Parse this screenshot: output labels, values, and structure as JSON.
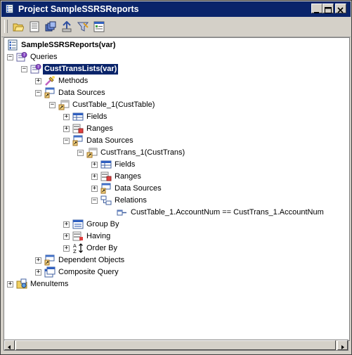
{
  "window": {
    "title": "Project SampleSSRSReports"
  },
  "toolbar": {
    "buttons": [
      "open-icon",
      "properties-icon",
      "compile-icon",
      "add-to-version-control-icon",
      "filter-icon",
      "report-icon"
    ]
  },
  "tree": {
    "root": "SampleSSRSReports(var)",
    "queries": "Queries",
    "query": "CustTransLists(var)",
    "methods": "Methods",
    "data_sources": "Data Sources",
    "cust_table": "CustTable_1(CustTable)",
    "ct_fields": "Fields",
    "ct_ranges": "Ranges",
    "ct_data_sources": "Data Sources",
    "cust_trans": "CustTrans_1(CustTrans)",
    "tr_fields": "Fields",
    "tr_ranges": "Ranges",
    "tr_data_sources": "Data Sources",
    "tr_relations": "Relations",
    "relation": "CustTable_1.AccountNum == CustTrans_1.AccountNum",
    "group_by": "Group By",
    "having": "Having",
    "order_by": "Order By",
    "dependent_objects": "Dependent Objects",
    "composite_query": "Composite Query",
    "menu_items": "MenuItems"
  }
}
